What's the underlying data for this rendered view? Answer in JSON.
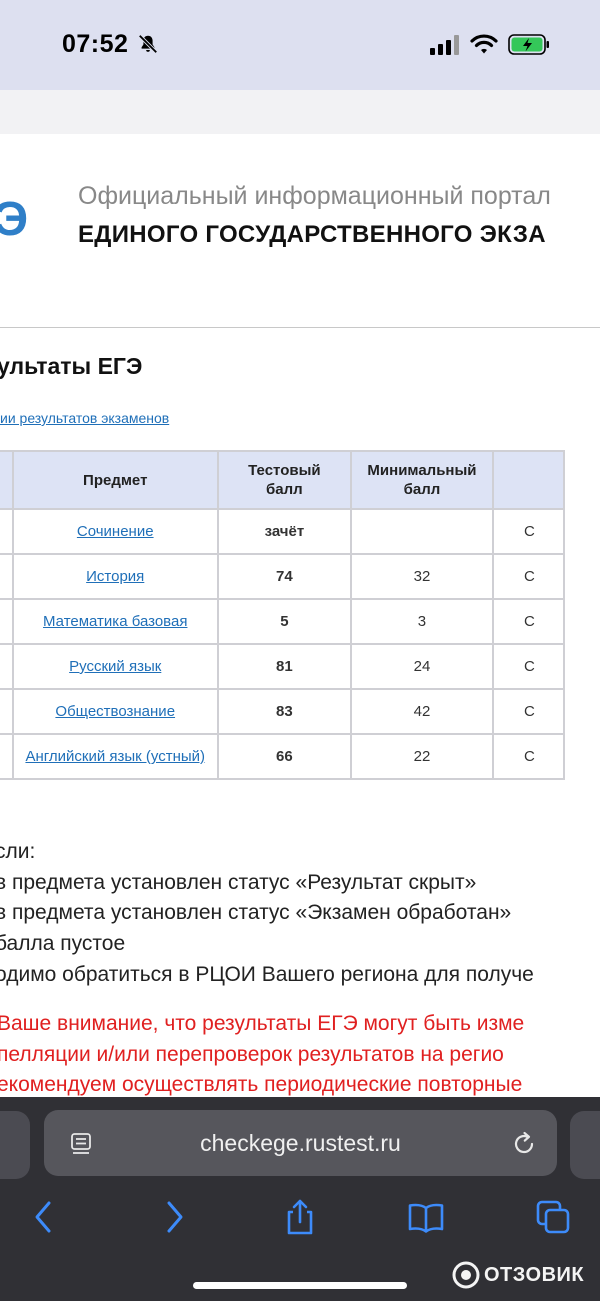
{
  "status_bar": {
    "time": "07:52"
  },
  "portal": {
    "line1": "Официальный информационный портал",
    "line2": "ЕДИНОГО ГОСУДАРСТВЕННОГО ЭКЗА",
    "logo_letter": "Э"
  },
  "page": {
    "title": "ультаты ЕГЭ",
    "history_link": "ии результатов экзаменов"
  },
  "table": {
    "headers": {
      "subject": "Предмет",
      "test_score": "Тестовый\nбалл",
      "min_score": "Минимальный\nбалл"
    },
    "rows": [
      {
        "subject": "Сочинение",
        "score": "зачёт",
        "min": "",
        "status": "С"
      },
      {
        "subject": "История",
        "score": "74",
        "min": "32",
        "status": "С"
      },
      {
        "subject": "Математика базовая",
        "score": "5",
        "min": "3",
        "status": "С"
      },
      {
        "subject": "Русский язык",
        "score": "81",
        "min": "24",
        "status": "С"
      },
      {
        "subject": "Обществознание",
        "score": "83",
        "min": "42",
        "status": "С"
      },
      {
        "subject": "Английский язык (устный)",
        "score": "66",
        "min": "22",
        "status": "С"
      }
    ]
  },
  "notes": {
    "lines": [
      "сли:",
      "в предмета установлен статус «Результат скрыт»",
      "в предмета установлен статус «Экзамен обработан»",
      "балла пустое",
      "одимо обратиться в РЦОИ Вашего региона для получе"
    ],
    "warning_lines": [
      " Ваше внимание, что результаты ЕГЭ могут быть изме",
      "пелляции и/или перепроверок результатов на регио",
      "екомендуем осуществлять периодические повторные"
    ]
  },
  "browser": {
    "url": "checkege.rustest.ru",
    "watermark": "ОТЗОВИК"
  },
  "colors": {
    "link": "#1f6fb8",
    "score": "#2f8a2a",
    "warning": "#e02020",
    "header_bg": "#dde3f5",
    "status_bar_bg": "#dde0f0",
    "browser_bg": "#303035",
    "ios_blue": "#3d8bfa"
  },
  "icons": {
    "status": [
      "bell-slash-icon",
      "cellular-signal-icon",
      "wifi-icon",
      "battery-charging-icon"
    ],
    "browser": [
      "reader-mode-icon",
      "reload-icon",
      "back-icon",
      "forward-icon",
      "share-icon",
      "bookmarks-icon",
      "tabs-icon"
    ]
  }
}
